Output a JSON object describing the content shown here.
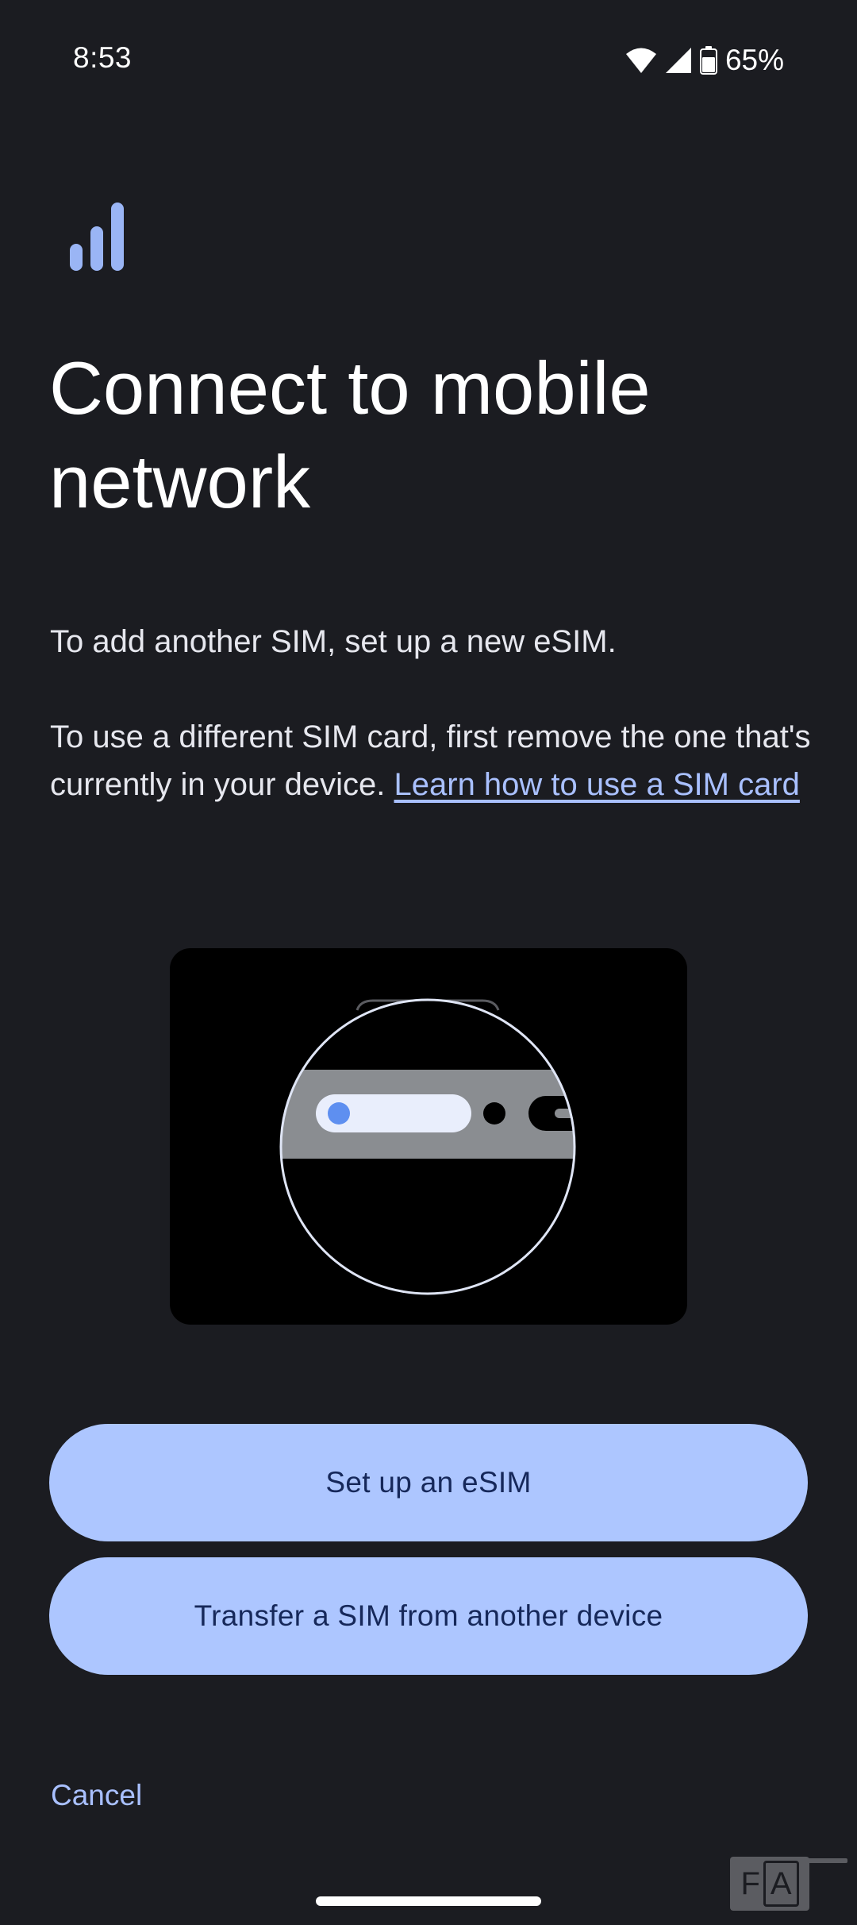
{
  "status_bar": {
    "time": "8:53",
    "battery_percent": "65%",
    "icons": [
      "wifi-icon",
      "cell-signal-icon",
      "battery-icon"
    ]
  },
  "header": {
    "icon": "signal-bars-icon",
    "title": "Connect to mobile network"
  },
  "body": {
    "paragraph_1": "To add another SIM, set up a new eSIM.",
    "paragraph_2": "To use a different SIM card, first remove the one that's currently in your device. ",
    "link_text": "Learn how to use a SIM card"
  },
  "illustration": {
    "icon": "sim-tray-illustration"
  },
  "actions": {
    "primary_label": "Set up an eSIM",
    "secondary_label": "Transfer a SIM from another device",
    "cancel_label": "Cancel"
  },
  "overlay": {
    "badge_left": "F",
    "badge_right": "A"
  },
  "colors": {
    "background": "#1b1c21",
    "accent": "#adc6ff",
    "button_text": "#16285a",
    "link": "#a9c0ff"
  }
}
